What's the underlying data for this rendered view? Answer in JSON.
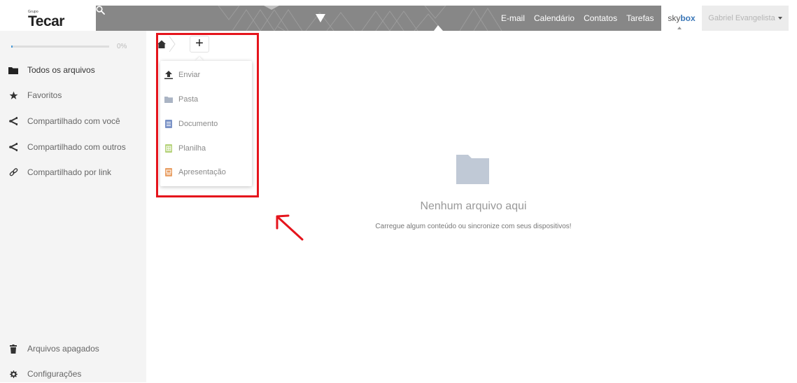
{
  "header": {
    "logo_small": "Grupo",
    "logo": "Tecar",
    "nav": [
      "E-mail",
      "Calendário",
      "Contatos",
      "Tarefas"
    ],
    "brand_part1": "sky",
    "brand_part2": "box",
    "user_name": "Gabriel Evangelista",
    "icons": [
      "search-icon",
      "chevron-down-icon"
    ]
  },
  "sidebar": {
    "quota_label": "0%",
    "quota_fraction": 0.01,
    "items": [
      {
        "label": "Todos os arquivos",
        "icon": "folder-icon"
      },
      {
        "label": "Favoritos",
        "icon": "star-icon"
      },
      {
        "label": "Compartilhado com você",
        "icon": "share-icon"
      },
      {
        "label": "Compartilhado com outros",
        "icon": "share-icon"
      },
      {
        "label": "Compartilhado por link",
        "icon": "link-icon"
      }
    ],
    "bottom": [
      {
        "label": "Arquivos apagados",
        "icon": "trash-icon"
      },
      {
        "label": "Configurações",
        "icon": "gear-icon"
      }
    ]
  },
  "breadcrumb": {
    "home_icon": "home-icon",
    "new_button": "+"
  },
  "new_menu": {
    "items": [
      {
        "label": "Enviar",
        "icon": "upload-icon"
      },
      {
        "label": "Pasta",
        "icon": "folder-icon"
      },
      {
        "label": "Documento",
        "icon": "document-icon"
      },
      {
        "label": "Planilha",
        "icon": "spreadsheet-icon"
      },
      {
        "label": "Apresentação",
        "icon": "presentation-icon"
      }
    ]
  },
  "empty_state": {
    "title": "Nenhum arquivo aqui",
    "subtitle": "Carregue algum conteúdo ou sincronize com seus dispositivos!",
    "icon": "folder-icon"
  },
  "colors": {
    "banner": "#878787",
    "brand_accent": "#3b77b8",
    "annotation": "#e5141c",
    "document": "#7b93c7",
    "spreadsheet": "#b6d37b",
    "presentation": "#e9a066",
    "folder": "#c0c9d6"
  }
}
